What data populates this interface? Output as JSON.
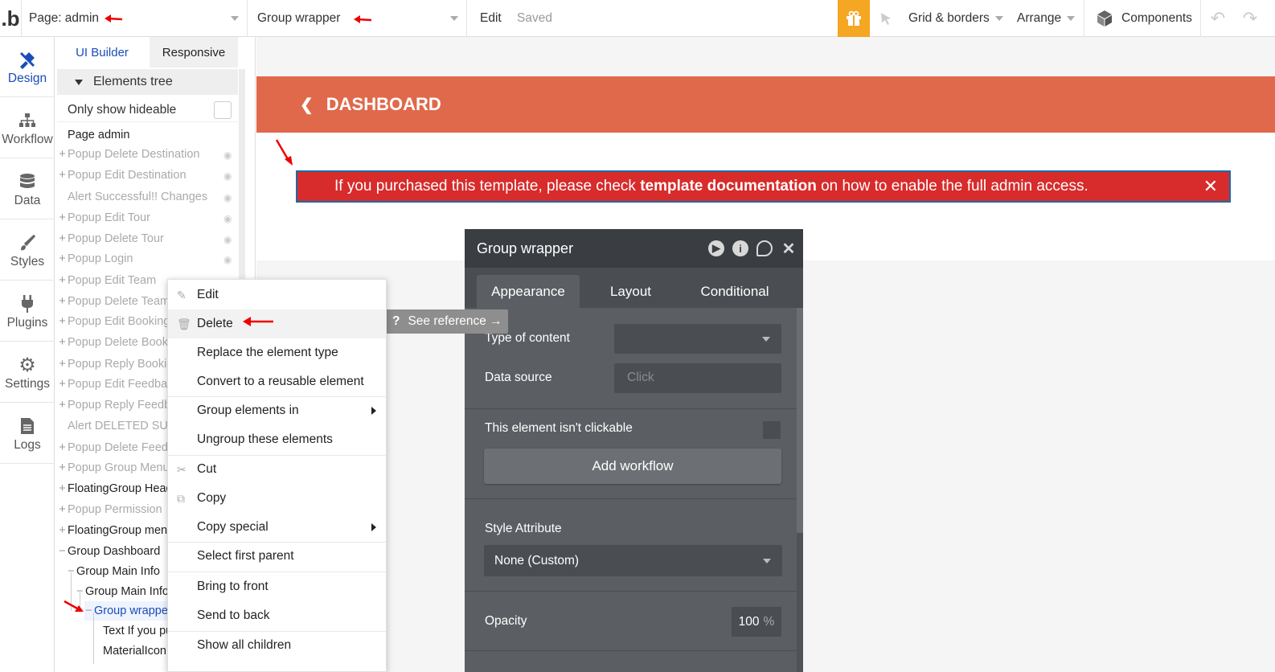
{
  "topbar": {
    "logo": ".b",
    "page_selector": "Page: admin",
    "element_selector": "Group wrapper",
    "edit": "Edit",
    "saved": "Saved",
    "grid_borders": "Grid & borders",
    "arrange": "Arrange",
    "components": "Components"
  },
  "leftnav": [
    {
      "label": "Design",
      "icon": "design-icon"
    },
    {
      "label": "Workflow",
      "icon": "workflow-icon"
    },
    {
      "label": "Data",
      "icon": "database-icon"
    },
    {
      "label": "Styles",
      "icon": "brush-icon"
    },
    {
      "label": "Plugins",
      "icon": "plug-icon"
    },
    {
      "label": "Settings",
      "icon": "gear-icon"
    },
    {
      "label": "Logs",
      "icon": "document-icon"
    }
  ],
  "panel": {
    "tabs": [
      "UI Builder",
      "Responsive"
    ],
    "tree_header": "Elements tree",
    "only_hideable": "Only show hideable",
    "items": [
      {
        "label": "Page admin",
        "prefix": ""
      },
      {
        "label": "Popup Delete Destination",
        "prefix": "+"
      },
      {
        "label": "Popup Edit Destination",
        "prefix": "+"
      },
      {
        "label": "Alert Successful!! Changes",
        "prefix": ""
      },
      {
        "label": "Popup Edit Tour",
        "prefix": "+"
      },
      {
        "label": "Popup Delete Tour",
        "prefix": "+"
      },
      {
        "label": "Popup Login",
        "prefix": "+"
      },
      {
        "label": "Popup Edit Team",
        "prefix": "+"
      },
      {
        "label": "Popup Delete Team",
        "prefix": "+"
      },
      {
        "label": "Popup Edit Booking",
        "prefix": "+"
      },
      {
        "label": "Popup Delete Booki",
        "prefix": "+"
      },
      {
        "label": "Popup Reply Bookin",
        "prefix": "+"
      },
      {
        "label": "Popup Edit Feedbac",
        "prefix": "+"
      },
      {
        "label": "Popup Reply Feedba",
        "prefix": "+"
      },
      {
        "label": "Alert DELETED SUC",
        "prefix": ""
      },
      {
        "label": "Popup Delete Feedb",
        "prefix": "+"
      },
      {
        "label": "Popup Group Menu",
        "prefix": "+"
      },
      {
        "label": "FloatingGroup Head",
        "prefix": "+"
      },
      {
        "label": "Popup Permission",
        "prefix": "+"
      },
      {
        "label": "FloatingGroup men",
        "prefix": "+"
      },
      {
        "label": "Group Dashboard",
        "prefix": "−"
      },
      {
        "label": "Group Main Info",
        "prefix": "−"
      },
      {
        "label": "Group Main Info",
        "prefix": "−"
      },
      {
        "label": "Group wrappe",
        "prefix": "−"
      },
      {
        "label": "Text If you pu",
        "prefix": ""
      },
      {
        "label": "MaterialIcon",
        "prefix": ""
      }
    ]
  },
  "canvas": {
    "header_title": "DASHBOARD",
    "alert_pre": "If you purchased this template, please check ",
    "alert_bold": "template documentation",
    "alert_post": " on how to enable the full admin access.",
    "alert_close": "✕"
  },
  "context_menu": {
    "items": [
      "Edit",
      "Delete",
      "Replace the element type",
      "Convert to a reusable element",
      "Group elements in",
      "Ungroup these elements",
      "Cut",
      "Copy",
      "Copy special",
      "Select first parent",
      "Bring to front",
      "Send to back",
      "Show all children"
    ],
    "see_reference": "See reference →"
  },
  "property_editor": {
    "title": "Group wrapper",
    "tabs": [
      "Appearance",
      "Layout",
      "Conditional"
    ],
    "type_of_content_label": "Type of content",
    "data_source_label": "Data source",
    "data_source_placeholder": "Click",
    "not_clickable_label": "This element isn't clickable",
    "add_workflow": "Add workflow",
    "style_attribute_label": "Style Attribute",
    "style_value": "None (Custom)",
    "opacity_label": "Opacity",
    "opacity_value": "100",
    "opacity_unit": "%"
  },
  "colors": {
    "accent_blue": "#1a4db8",
    "header_orange": "#e0694b",
    "alert_red": "#d82b2b",
    "gift_orange": "#f5a623",
    "editor_bg": "#5b5f63"
  }
}
